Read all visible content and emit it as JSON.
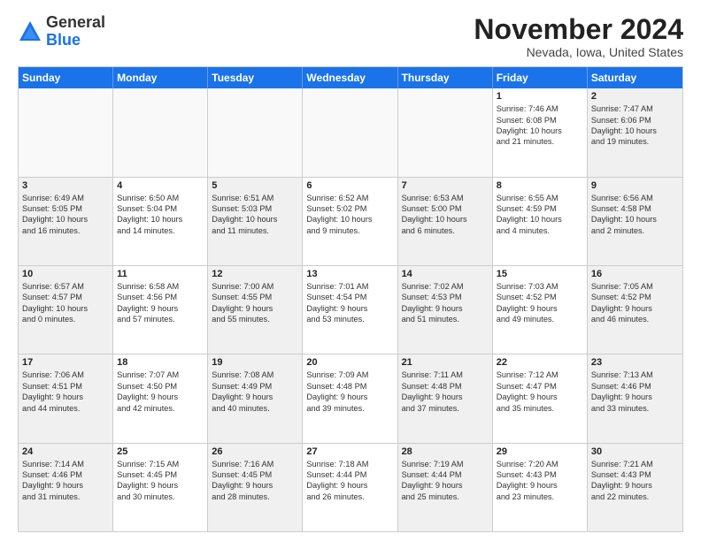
{
  "header": {
    "logo_general": "General",
    "logo_blue": "Blue",
    "month_year": "November 2024",
    "location": "Nevada, Iowa, United States"
  },
  "weekdays": [
    "Sunday",
    "Monday",
    "Tuesday",
    "Wednesday",
    "Thursday",
    "Friday",
    "Saturday"
  ],
  "rows": [
    [
      {
        "day": "",
        "text": "",
        "empty": true
      },
      {
        "day": "",
        "text": "",
        "empty": true
      },
      {
        "day": "",
        "text": "",
        "empty": true
      },
      {
        "day": "",
        "text": "",
        "empty": true
      },
      {
        "day": "",
        "text": "",
        "empty": true
      },
      {
        "day": "1",
        "text": "Sunrise: 7:46 AM\nSunset: 6:08 PM\nDaylight: 10 hours\nand 21 minutes."
      },
      {
        "day": "2",
        "text": "Sunrise: 7:47 AM\nSunset: 6:06 PM\nDaylight: 10 hours\nand 19 minutes.",
        "shaded": true
      }
    ],
    [
      {
        "day": "3",
        "text": "Sunrise: 6:49 AM\nSunset: 5:05 PM\nDaylight: 10 hours\nand 16 minutes.",
        "shaded": true
      },
      {
        "day": "4",
        "text": "Sunrise: 6:50 AM\nSunset: 5:04 PM\nDaylight: 10 hours\nand 14 minutes."
      },
      {
        "day": "5",
        "text": "Sunrise: 6:51 AM\nSunset: 5:03 PM\nDaylight: 10 hours\nand 11 minutes.",
        "shaded": true
      },
      {
        "day": "6",
        "text": "Sunrise: 6:52 AM\nSunset: 5:02 PM\nDaylight: 10 hours\nand 9 minutes."
      },
      {
        "day": "7",
        "text": "Sunrise: 6:53 AM\nSunset: 5:00 PM\nDaylight: 10 hours\nand 6 minutes.",
        "shaded": true
      },
      {
        "day": "8",
        "text": "Sunrise: 6:55 AM\nSunset: 4:59 PM\nDaylight: 10 hours\nand 4 minutes."
      },
      {
        "day": "9",
        "text": "Sunrise: 6:56 AM\nSunset: 4:58 PM\nDaylight: 10 hours\nand 2 minutes.",
        "shaded": true
      }
    ],
    [
      {
        "day": "10",
        "text": "Sunrise: 6:57 AM\nSunset: 4:57 PM\nDaylight: 10 hours\nand 0 minutes.",
        "shaded": true
      },
      {
        "day": "11",
        "text": "Sunrise: 6:58 AM\nSunset: 4:56 PM\nDaylight: 9 hours\nand 57 minutes."
      },
      {
        "day": "12",
        "text": "Sunrise: 7:00 AM\nSunset: 4:55 PM\nDaylight: 9 hours\nand 55 minutes.",
        "shaded": true
      },
      {
        "day": "13",
        "text": "Sunrise: 7:01 AM\nSunset: 4:54 PM\nDaylight: 9 hours\nand 53 minutes."
      },
      {
        "day": "14",
        "text": "Sunrise: 7:02 AM\nSunset: 4:53 PM\nDaylight: 9 hours\nand 51 minutes.",
        "shaded": true
      },
      {
        "day": "15",
        "text": "Sunrise: 7:03 AM\nSunset: 4:52 PM\nDaylight: 9 hours\nand 49 minutes."
      },
      {
        "day": "16",
        "text": "Sunrise: 7:05 AM\nSunset: 4:52 PM\nDaylight: 9 hours\nand 46 minutes.",
        "shaded": true
      }
    ],
    [
      {
        "day": "17",
        "text": "Sunrise: 7:06 AM\nSunset: 4:51 PM\nDaylight: 9 hours\nand 44 minutes.",
        "shaded": true
      },
      {
        "day": "18",
        "text": "Sunrise: 7:07 AM\nSunset: 4:50 PM\nDaylight: 9 hours\nand 42 minutes."
      },
      {
        "day": "19",
        "text": "Sunrise: 7:08 AM\nSunset: 4:49 PM\nDaylight: 9 hours\nand 40 minutes.",
        "shaded": true
      },
      {
        "day": "20",
        "text": "Sunrise: 7:09 AM\nSunset: 4:48 PM\nDaylight: 9 hours\nand 39 minutes."
      },
      {
        "day": "21",
        "text": "Sunrise: 7:11 AM\nSunset: 4:48 PM\nDaylight: 9 hours\nand 37 minutes.",
        "shaded": true
      },
      {
        "day": "22",
        "text": "Sunrise: 7:12 AM\nSunset: 4:47 PM\nDaylight: 9 hours\nand 35 minutes."
      },
      {
        "day": "23",
        "text": "Sunrise: 7:13 AM\nSunset: 4:46 PM\nDaylight: 9 hours\nand 33 minutes.",
        "shaded": true
      }
    ],
    [
      {
        "day": "24",
        "text": "Sunrise: 7:14 AM\nSunset: 4:46 PM\nDaylight: 9 hours\nand 31 minutes.",
        "shaded": true
      },
      {
        "day": "25",
        "text": "Sunrise: 7:15 AM\nSunset: 4:45 PM\nDaylight: 9 hours\nand 30 minutes."
      },
      {
        "day": "26",
        "text": "Sunrise: 7:16 AM\nSunset: 4:45 PM\nDaylight: 9 hours\nand 28 minutes.",
        "shaded": true
      },
      {
        "day": "27",
        "text": "Sunrise: 7:18 AM\nSunset: 4:44 PM\nDaylight: 9 hours\nand 26 minutes."
      },
      {
        "day": "28",
        "text": "Sunrise: 7:19 AM\nSunset: 4:44 PM\nDaylight: 9 hours\nand 25 minutes.",
        "shaded": true
      },
      {
        "day": "29",
        "text": "Sunrise: 7:20 AM\nSunset: 4:43 PM\nDaylight: 9 hours\nand 23 minutes."
      },
      {
        "day": "30",
        "text": "Sunrise: 7:21 AM\nSunset: 4:43 PM\nDaylight: 9 hours\nand 22 minutes.",
        "shaded": true
      }
    ]
  ]
}
